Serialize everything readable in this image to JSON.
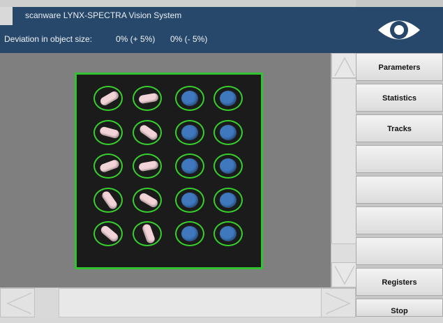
{
  "window": {
    "title": "scanware LYNX-SPECTRA Vision System"
  },
  "status": {
    "label": "Deviation in object size:",
    "value_plus": "0% (+ 5%)",
    "value_minus": "0% (- 5%)"
  },
  "sidebar": {
    "logo_icon": "eye-icon",
    "buttons": [
      {
        "label": "Parameters"
      },
      {
        "label": "Statistics"
      },
      {
        "label": "Tracks"
      },
      {
        "label": ""
      },
      {
        "label": ""
      },
      {
        "label": ""
      },
      {
        "label": ""
      },
      {
        "label": "Registers"
      },
      {
        "label": "Stop"
      }
    ]
  },
  "inspection": {
    "rows": 5,
    "columns": [
      {
        "type": "tablet-white"
      },
      {
        "type": "tablet-white"
      },
      {
        "type": "disc-blue"
      },
      {
        "type": "disc-blue"
      }
    ],
    "colors": {
      "frame": "#31c22f",
      "ring": "#37d02c",
      "tablet": "#f2d3d7",
      "disc": "#3f78bd"
    }
  }
}
